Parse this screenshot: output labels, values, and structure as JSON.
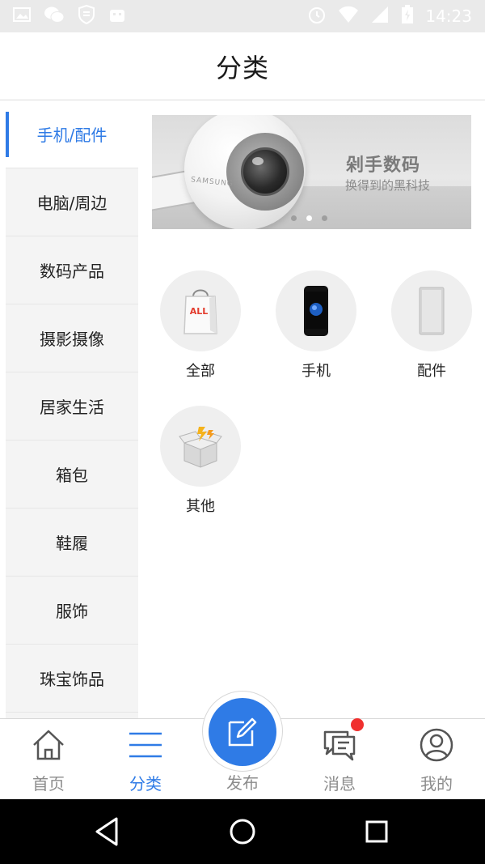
{
  "status_bar": {
    "time": "14:23"
  },
  "header": {
    "title": "分类"
  },
  "sidebar": {
    "items": [
      {
        "label": "手机/配件",
        "active": true
      },
      {
        "label": "电脑/周边",
        "active": false
      },
      {
        "label": "数码产品",
        "active": false
      },
      {
        "label": "摄影摄像",
        "active": false
      },
      {
        "label": "居家生活",
        "active": false
      },
      {
        "label": "箱包",
        "active": false
      },
      {
        "label": "鞋履",
        "active": false
      },
      {
        "label": "服饰",
        "active": false
      },
      {
        "label": "珠宝饰品",
        "active": false
      }
    ]
  },
  "banner": {
    "headline": "剁手数码",
    "subline": "换得到的黑科技",
    "product_brand": "SAMSUNG",
    "dots_count": 3,
    "active_dot_index": 1
  },
  "categories": [
    {
      "label": "全部",
      "icon": "shopping-bag-all-icon",
      "badge_text": "ALL"
    },
    {
      "label": "手机",
      "icon": "phone-icon"
    },
    {
      "label": "配件",
      "icon": "power-bank-icon"
    },
    {
      "label": "其他",
      "icon": "open-box-icon"
    }
  ],
  "bottom_nav": {
    "items": [
      {
        "label": "首页",
        "icon": "home-icon",
        "active": false
      },
      {
        "label": "分类",
        "icon": "list-icon",
        "active": true
      },
      {
        "label": "发布",
        "icon": "edit-icon",
        "active": false
      },
      {
        "label": "消息",
        "icon": "message-icon",
        "active": false,
        "has_badge": true
      },
      {
        "label": "我的",
        "icon": "user-icon",
        "active": false
      }
    ]
  },
  "colors": {
    "accent": "#2f7be6",
    "badge": "#f0302e",
    "sidebar_bg": "#f4f4f4",
    "status_bar_bg": "#eaeaea"
  }
}
